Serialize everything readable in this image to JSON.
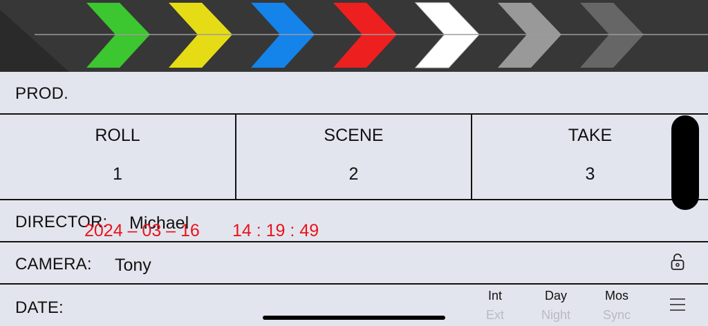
{
  "clapper": {
    "stripe_colors": [
      "#3cc62f",
      "#e6dc16",
      "#1483ea",
      "#ee1f1f",
      "#ffffff",
      "#999999",
      "#666666"
    ],
    "background": "#373737"
  },
  "prod": {
    "label": "PROD."
  },
  "roll": {
    "label": "ROLL",
    "value": "1"
  },
  "scene": {
    "label": "SCENE",
    "value": "2"
  },
  "take": {
    "label": "TAKE",
    "value": "3"
  },
  "director": {
    "label": "DIRECTOR:",
    "value": "Michael"
  },
  "camera": {
    "label": "CAMERA:",
    "value": "Tony",
    "lock_icon": "lock-icon"
  },
  "date": {
    "label": "DATE:",
    "date_value": "2024 – 03 – 16",
    "time_value": "14 : 19 : 49",
    "color": "#e8141c"
  },
  "toggles": {
    "int_ext": {
      "on": "Int",
      "off": "Ext"
    },
    "day_night": {
      "on": "Day",
      "off": "Night"
    },
    "mos_sync": {
      "on": "Mos",
      "off": "Sync"
    }
  },
  "menu_icon": "hamburger-menu-icon"
}
